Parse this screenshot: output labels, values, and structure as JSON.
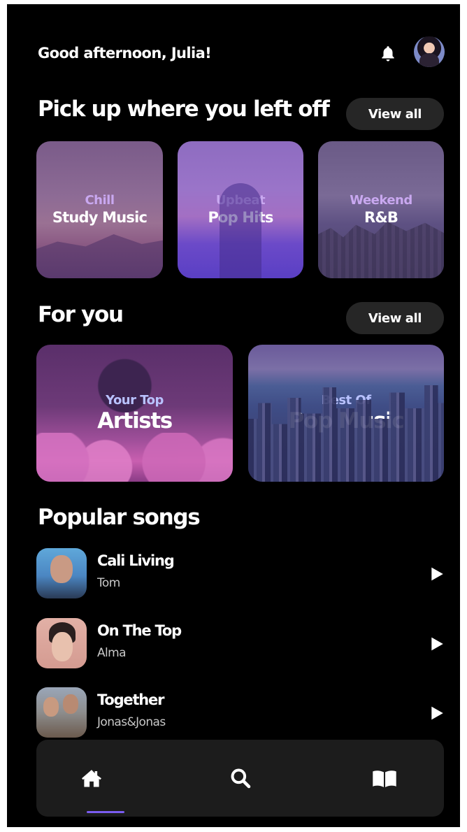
{
  "header": {
    "greeting": "Good afternoon, Julia!",
    "icons": [
      "bell-icon",
      "avatar"
    ]
  },
  "sections": {
    "recent": {
      "title": "Pick up where you left off",
      "view_all": "View all",
      "cards": [
        {
          "sub": "Chill",
          "main": "Study Music"
        },
        {
          "sub": "Upbeat",
          "main": "Pop Hits"
        },
        {
          "sub": "Weekend",
          "main": "R&B"
        }
      ]
    },
    "for_you": {
      "title": "For you",
      "view_all": "View all",
      "cards": [
        {
          "sub": "Your Top",
          "main": "Artists"
        },
        {
          "sub": "Best Of",
          "main": "Pop Music"
        }
      ]
    },
    "popular": {
      "title": "Popular songs",
      "songs": [
        {
          "title": "Cali Living",
          "artist": "Tom"
        },
        {
          "title": "On The Top",
          "artist": "Alma"
        },
        {
          "title": "Together",
          "artist": "Jonas&Jonas"
        }
      ]
    }
  },
  "bottom_nav": {
    "items": [
      "home-icon",
      "search-icon",
      "library-icon"
    ],
    "active": "home-icon"
  },
  "colors": {
    "background": "#000000",
    "card": "#262626",
    "nav": "#1c1c1c",
    "accent": "#7a5cf0"
  }
}
